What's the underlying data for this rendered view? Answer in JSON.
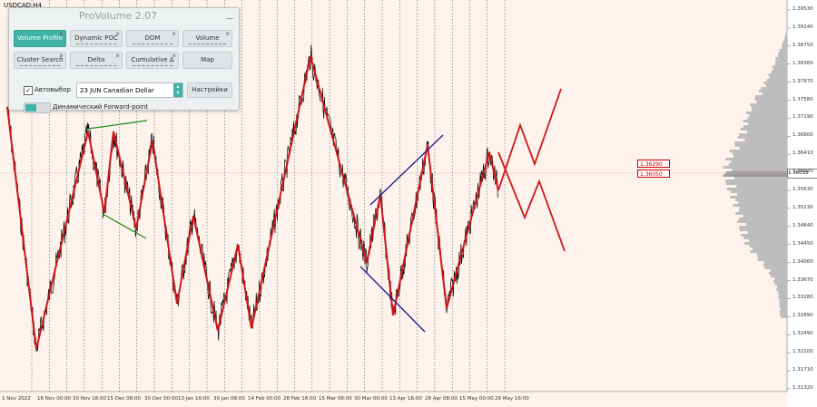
{
  "symbol": "USDCAD,H4",
  "panel": {
    "title": "ProVolume 2.07",
    "buttons": {
      "volume_profile": "Volume Profile",
      "dynamic_poc": "Dynamic POC",
      "dom": "DOM",
      "volume": "Volume",
      "cluster_search": "Cluster Search",
      "delta": "Delta",
      "cumulative_delta": "Cumulative Δ",
      "map": "Map"
    },
    "auto_select_label": "Автовыбор",
    "instrument": "23 JUN Canadian Dollar",
    "settings_button": "Настройки",
    "forward_point_label": "Динамический Forward-point"
  },
  "price_axis": [
    "1.39530",
    "1.39140",
    "1.38750",
    "1.38360",
    "1.37970",
    "1.37580",
    "1.37190",
    "1.36800",
    "1.36410",
    "1.36020",
    "1.35630",
    "1.35230",
    "1.34840",
    "1.34450",
    "1.34060",
    "1.33670",
    "1.33280",
    "1.32890",
    "1.32490",
    "1.32100",
    "1.31710",
    "1.31320"
  ],
  "price_labels": {
    "upper": "1.36290",
    "lower": "1.36050",
    "current": "1.36035"
  },
  "time_axis": [
    "1 Nov 2022",
    "16 Nov 00:00",
    "30 Nov 16:00",
    "15 Dec 08:00",
    "30 Dec 00:00",
    "13 Jan 16:00",
    "30 Jan 08:00",
    "14 Feb 00:00",
    "28 Feb 16:00",
    "15 Mar 08:00",
    "30 Mar 00:00",
    "13 Apr 16:00",
    "28 Apr 08:00",
    "15 May 00:00",
    "29 May 16:00"
  ],
  "colors": {
    "zigzag": "#d0161b",
    "channel_blue": "#1a1a8a",
    "channel_green": "#1e8a1e",
    "profile": "#b4b4b4",
    "accent": "#3fb3a5"
  }
}
